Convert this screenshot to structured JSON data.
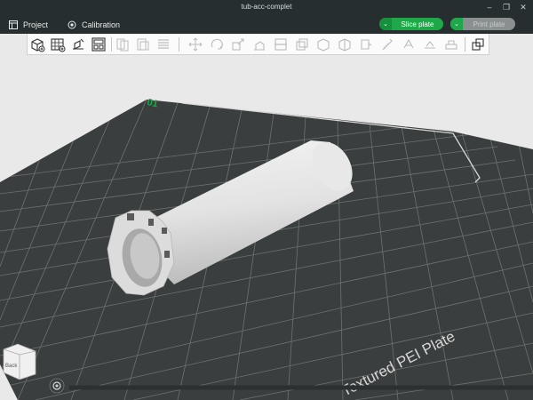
{
  "window": {
    "title": "tub-acc-complet",
    "minimize": "–",
    "restore": "❐",
    "close": "✕"
  },
  "menubar": {
    "project_label": "Project",
    "project_icon": "project-icon",
    "calibration_label": "Calibration",
    "calibration_icon": "calibration-icon",
    "slice_label": "Slice plate",
    "slice_chevron": "⌄",
    "print_label": "Print plate",
    "print_chevron": "⌄"
  },
  "toolbar": {
    "buttons": [
      "add-object-icon",
      "add-plate-icon",
      "auto-orient-icon",
      "arrange-icon",
      "split-objects-icon",
      "split-parts-icon",
      "layers-icon",
      "move-icon",
      "rotate-icon",
      "scale-icon",
      "lay-on-face-icon",
      "cut-icon",
      "boolean-icon",
      "support-paint-icon",
      "seam-paint-icon",
      "color-paint-icon",
      "measure-icon",
      "text-icon",
      "emboss-icon",
      "assembly-view-icon"
    ]
  },
  "plate": {
    "number": "01",
    "name": "Textured PEI Plate"
  },
  "view_cube": {
    "label": "Back",
    "icon": "view-cube-icon"
  },
  "camera": {
    "icon": "camera-icon"
  },
  "colors": {
    "accent": "#1ea84a",
    "titlebar": "#262e30",
    "plate": "#3a3d3d",
    "grid": "#6b706f",
    "model": "#e4e4e4"
  }
}
